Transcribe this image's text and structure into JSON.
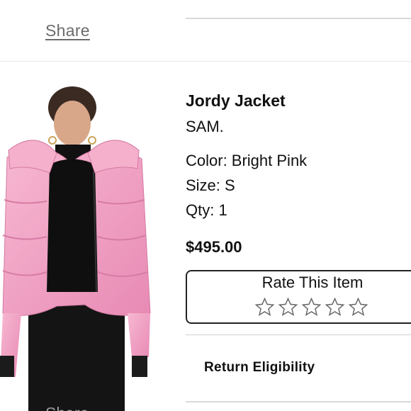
{
  "share": {
    "top_label": "Share",
    "bottom_label": "Share"
  },
  "product": {
    "title": "Jordy Jacket",
    "brand": "SAM.",
    "color": "Color: Bright Pink",
    "size": "Size: S",
    "qty": "Qty: 1",
    "price": "$495.00",
    "image_alt_icon": "pink-puffer-jacket-photo"
  },
  "rating": {
    "title": "Rate This Item",
    "stars_total": 5,
    "stars_filled": 0
  },
  "return_link": "Return Eligibility",
  "colors": {
    "jacket_pink": "#f2a3c4",
    "outline": "#222222"
  }
}
